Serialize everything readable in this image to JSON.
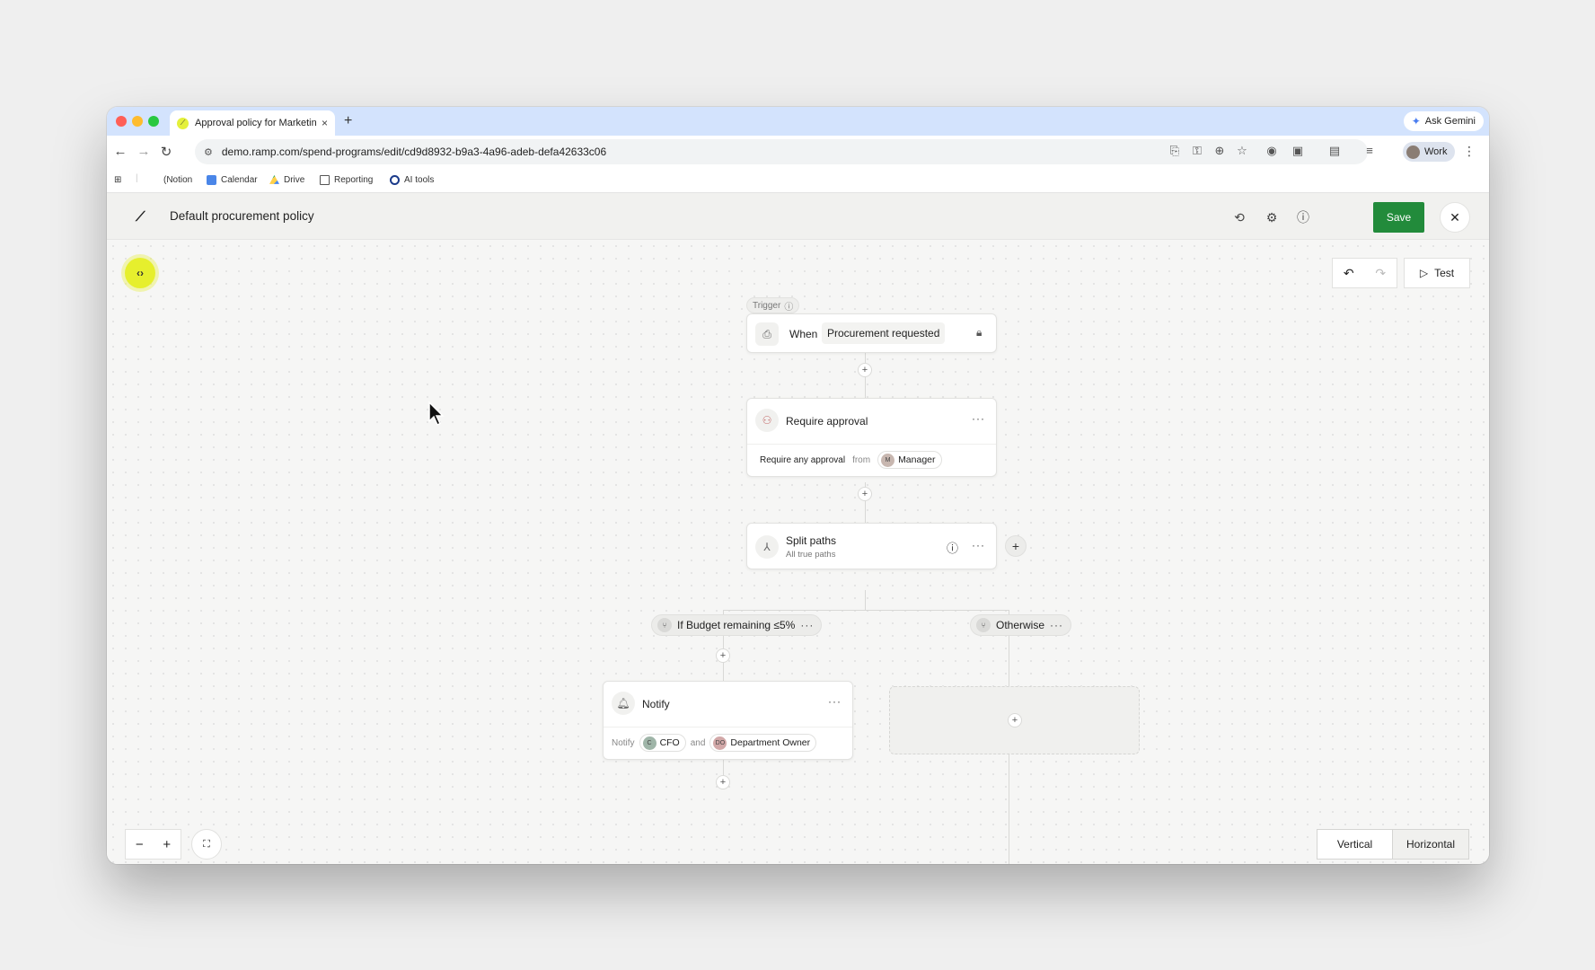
{
  "browser": {
    "tab_title": "Approval policy for Marketing",
    "tab_close": "×",
    "new_tab": "+",
    "ask_gemini": "Ask Gemini",
    "url": "demo.ramp.com/spend-programs/edit/cd9d8932-b9a3-4a96-adeb-defa42633c06",
    "profile_label": "Work",
    "bookmarks": [
      "(Notion",
      "Calendar",
      "Drive",
      "Reporting",
      "AI tools"
    ]
  },
  "header": {
    "title": "Default procurement policy",
    "save_label": "Save"
  },
  "canvas": {
    "test_label": "Test",
    "trigger": {
      "tag": "Trigger",
      "when": "When",
      "event": "Procurement requested"
    },
    "approval": {
      "title": "Require approval",
      "rule": "Require any approval",
      "from": "from",
      "approver": "Manager",
      "approver_initial": "M"
    },
    "split": {
      "title": "Split paths",
      "subtitle": "All true paths"
    },
    "branches": [
      {
        "label": "If Budget remaining ≤5%"
      },
      {
        "label": "Otherwise"
      }
    ],
    "notify": {
      "title": "Notify",
      "prefix": "Notify",
      "recipient1": "CFO",
      "recipient1_initial": "C",
      "and": "and",
      "recipient2": "Department Owner",
      "recipient2_initial": "DO"
    },
    "orientation": {
      "vertical": "Vertical",
      "horizontal": "Horizontal",
      "selected": "Vertical"
    }
  },
  "colors": {
    "save_green": "#228b3b",
    "accent_yellow": "#e6ef2d",
    "tabstrip_blue": "#d3e3fd"
  }
}
